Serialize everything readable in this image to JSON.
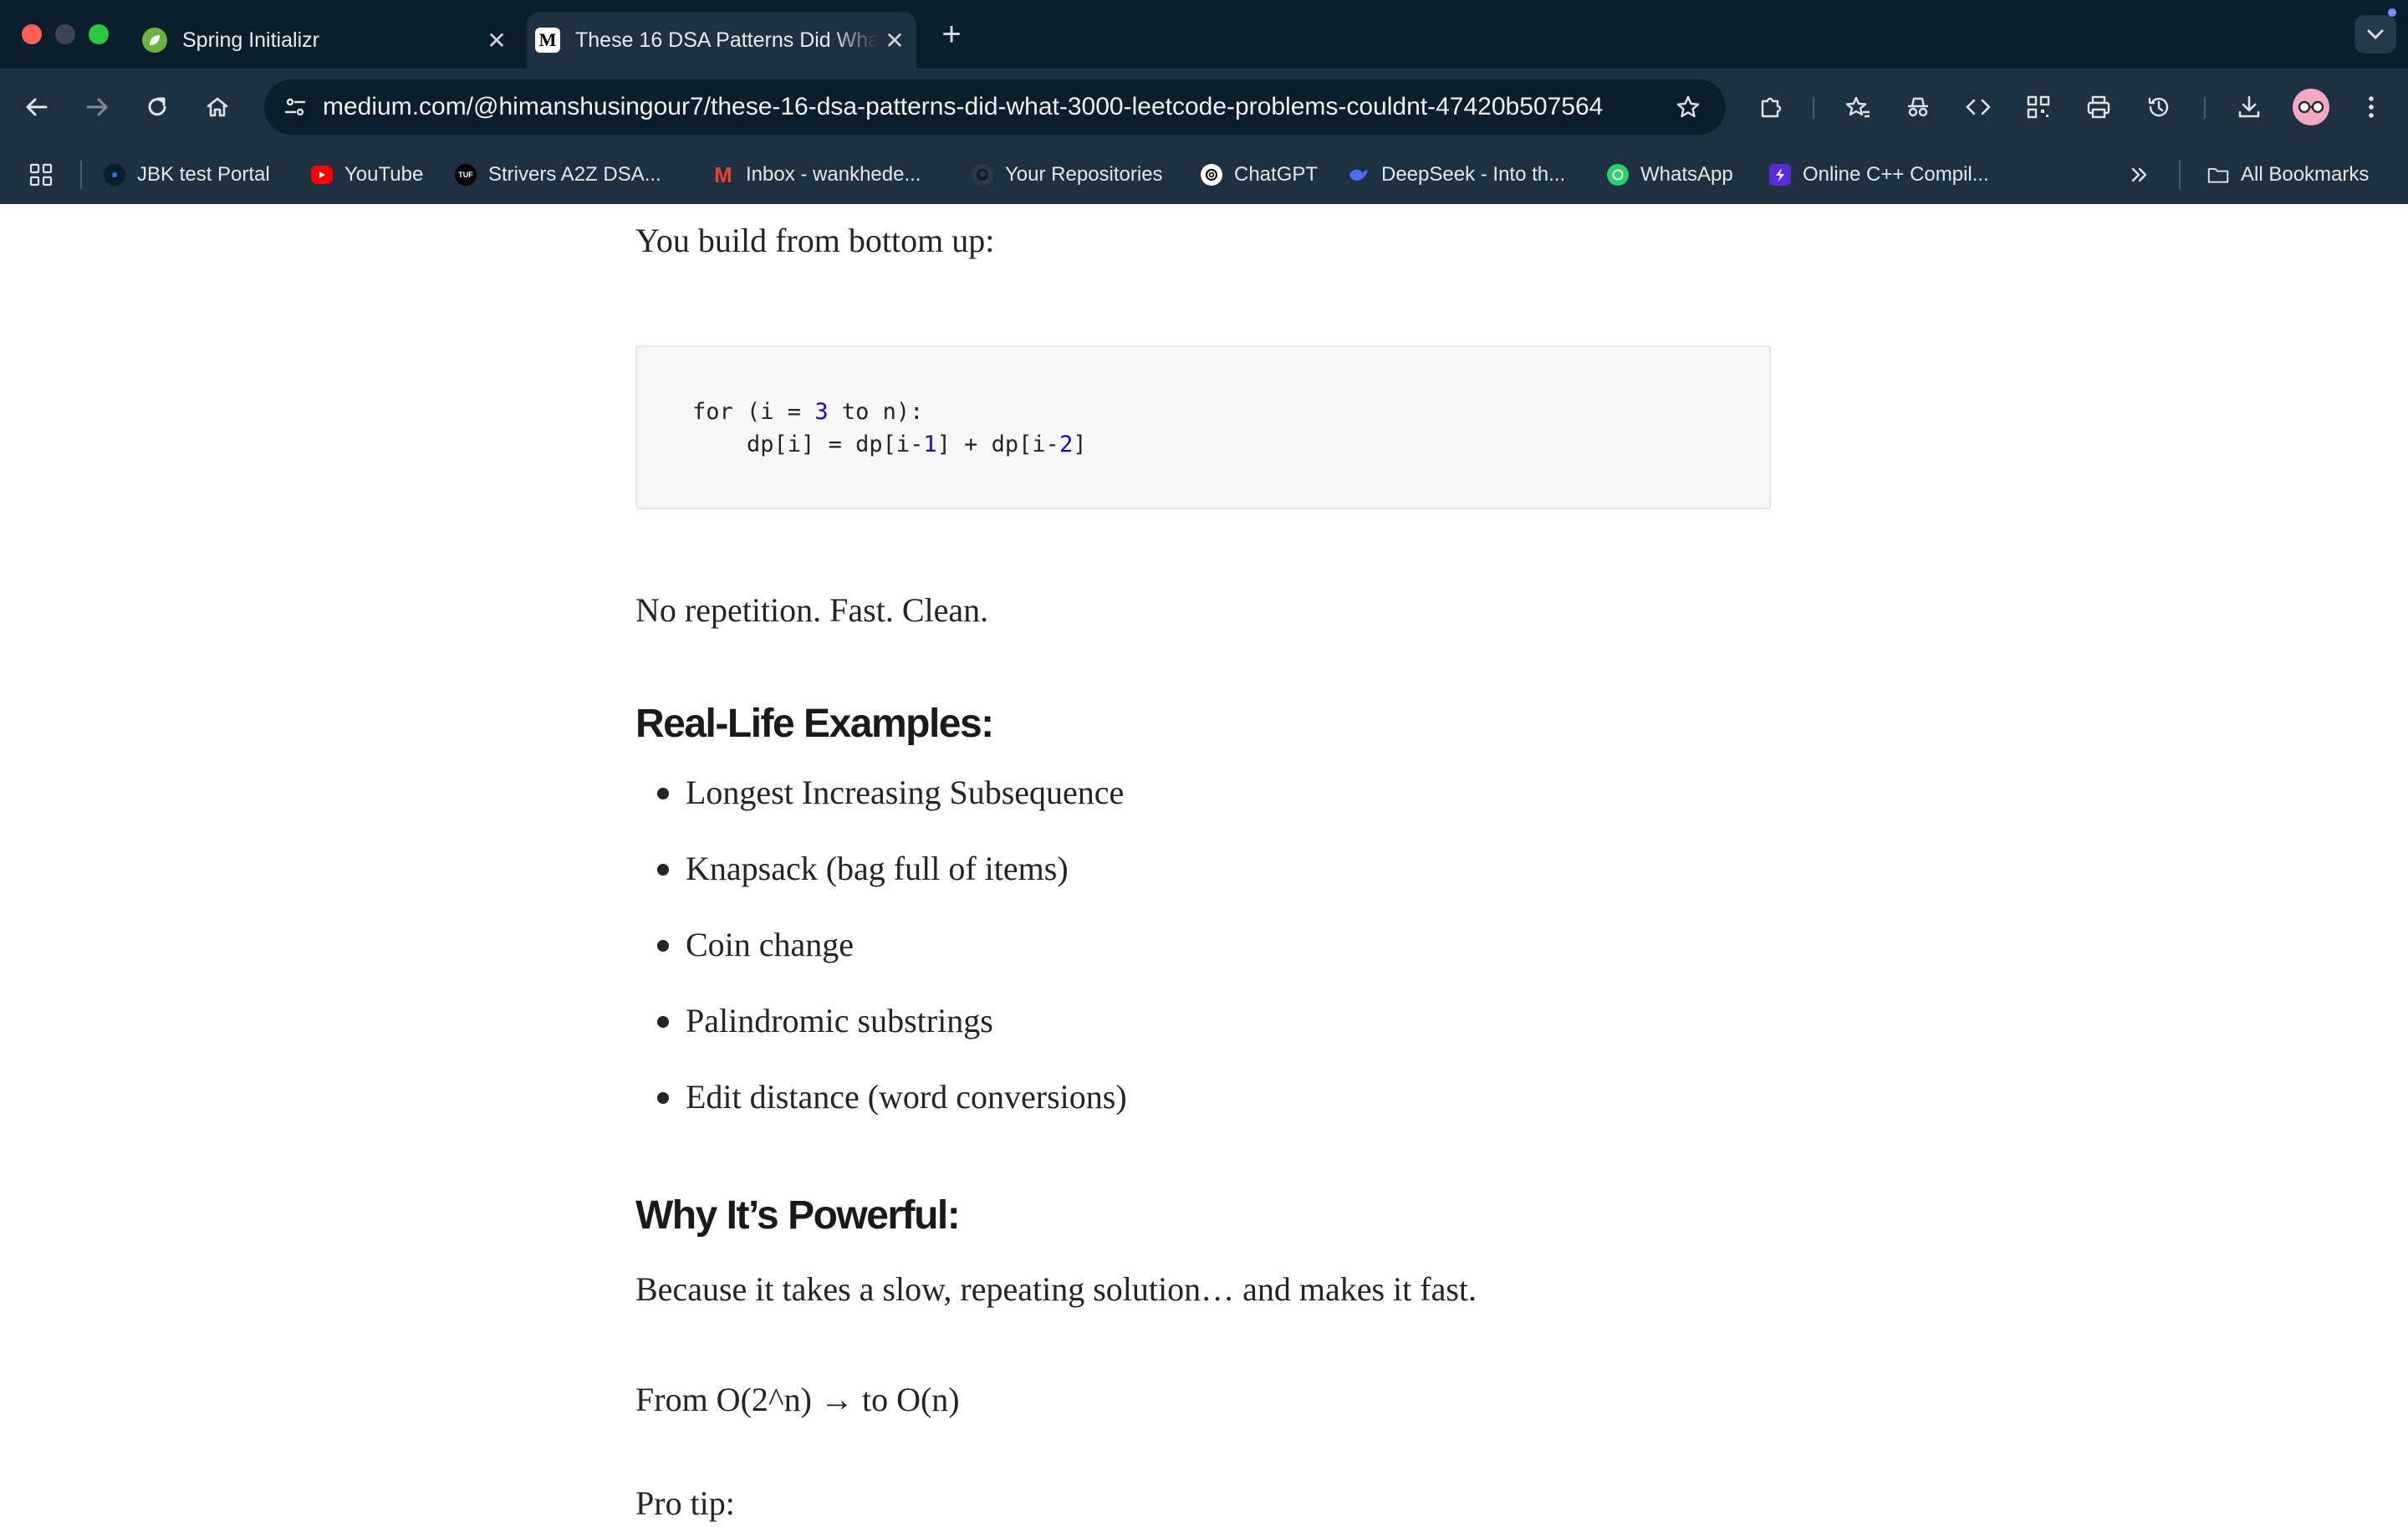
{
  "browser": {
    "tabs": [
      {
        "title": "Spring Initializr",
        "active": false,
        "favicon": "spring-leaf-icon"
      },
      {
        "title": "These 16 DSA Patterns Did What 3000 LeetCode Problems Couldn't",
        "active": true,
        "favicon": "medium-icon",
        "favicon_text": "M"
      }
    ],
    "new_tab_label": "+",
    "url": "medium.com/@himanshusingour7/these-16-dsa-patterns-did-what-3000-leetcode-problems-couldnt-47420b507564",
    "bookmarks": [
      {
        "label": "JBK test Portal",
        "icon": "jbk-icon"
      },
      {
        "label": "YouTube",
        "icon": "youtube-icon"
      },
      {
        "label": "Strivers A2Z DSA...",
        "icon": "tuf-icon",
        "icon_text": "TUF"
      },
      {
        "label": "Inbox - wankhede...",
        "icon": "gmail-icon",
        "icon_text": "M"
      },
      {
        "label": "Your Repositories",
        "icon": "github-icon"
      },
      {
        "label": "ChatGPT",
        "icon": "chatgpt-icon"
      },
      {
        "label": "DeepSeek - Into th...",
        "icon": "deepseek-icon"
      },
      {
        "label": "WhatsApp",
        "icon": "whatsapp-icon"
      },
      {
        "label": "Online C++ Compil...",
        "icon": "bolt-icon"
      }
    ],
    "all_bookmarks_label": "All Bookmarks",
    "colors": {
      "chrome_dark": "#0b1e2b",
      "chrome_toolbar": "#1d3140",
      "accent_dot": "#7c8cff"
    }
  },
  "article": {
    "intro": "You build from bottom up:",
    "code_lines": [
      "for (i = 3 to n):",
      "    dp[i] = dp[i-1] + dp[i-2]"
    ],
    "after_code": "No repetition. Fast. Clean.",
    "heading_examples": "Real-Life Examples:",
    "examples": [
      "Longest Increasing Subsequence",
      "Knapsack (bag full of items)",
      "Coin change",
      "Palindromic substrings",
      "Edit distance (word conversions)"
    ],
    "heading_powerful": "Why It’s Powerful:",
    "powerful_text": "Because it takes a slow, repeating solution… and makes it fast.",
    "complexity": "From O(2^n) → to O(n)",
    "pro_tip": "Pro tip:"
  }
}
